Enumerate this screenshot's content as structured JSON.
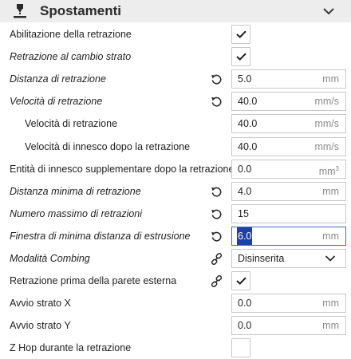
{
  "header": {
    "title": "Spostamenti"
  },
  "settings": [
    {
      "label": "Abilitazione della retrazione",
      "italic": false,
      "type": "checkbox",
      "checked": true
    },
    {
      "label": "Retrazione al cambio strato",
      "italic": true,
      "type": "checkbox",
      "checked": true
    },
    {
      "label": "Distanza di retrazione",
      "italic": true,
      "type": "number",
      "value": "5.0",
      "unit": "mm",
      "reset": true
    },
    {
      "label": "Velocità di retrazione",
      "italic": true,
      "type": "number",
      "value": "40.0",
      "unit": "mm/s",
      "reset": true
    },
    {
      "label": "Velocità di retrazione",
      "italic": false,
      "type": "number",
      "value": "40.0",
      "unit": "mm/s",
      "indent": true
    },
    {
      "label": "Velocità di innesco dopo la retrazione",
      "italic": false,
      "type": "number",
      "value": "40.0",
      "unit": "mm/s",
      "indent": true
    },
    {
      "label": "Entità di innesco supplementare dopo la retrazione",
      "italic": false,
      "type": "number",
      "value": "0.0",
      "unit": "mm",
      "unit_sup": "3"
    },
    {
      "label": "Distanza minima di retrazione",
      "italic": true,
      "type": "number",
      "value": "4.0",
      "unit": "mm",
      "reset": true
    },
    {
      "label": "Numero massimo di retrazioni",
      "italic": true,
      "type": "number",
      "value": "15",
      "unit": "",
      "reset": true
    },
    {
      "label": "Finestra di minima distanza di estrusione",
      "italic": true,
      "type": "number",
      "value": "6.0",
      "unit": "mm",
      "reset": true,
      "active": true
    },
    {
      "label": "Modalità Combing",
      "italic": true,
      "type": "dropdown",
      "value": "Disinserita",
      "link": true
    },
    {
      "label": "Retrazione prima della parete esterna",
      "italic": false,
      "type": "checkbox",
      "checked": true,
      "link": true
    },
    {
      "label": "Avvio strato X",
      "italic": false,
      "type": "number",
      "value": "0.0",
      "unit": "mm"
    },
    {
      "label": "Avvio strato Y",
      "italic": false,
      "type": "number",
      "value": "0.0",
      "unit": "mm"
    },
    {
      "label": "Z Hop durante la retrazione",
      "italic": false,
      "type": "checkbox",
      "checked": false
    }
  ]
}
